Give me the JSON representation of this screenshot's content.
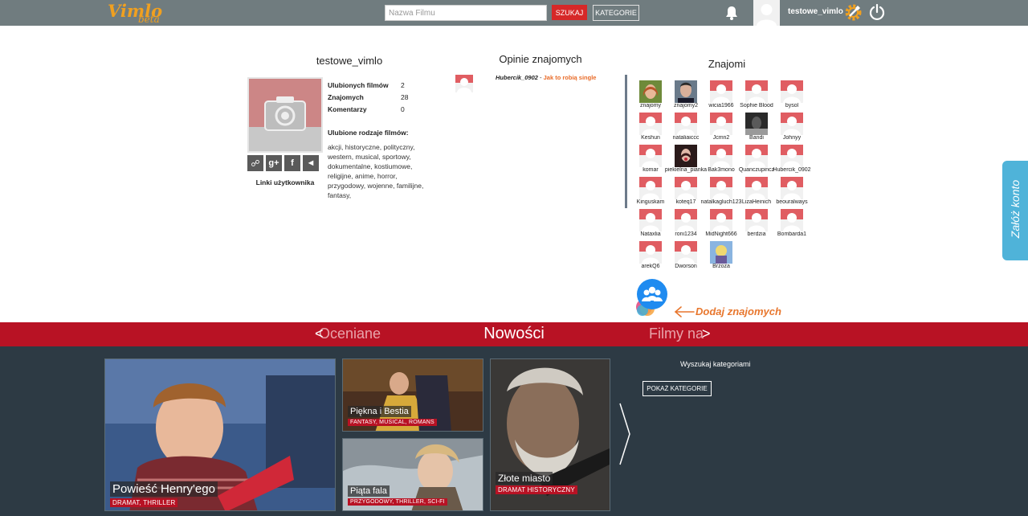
{
  "header": {
    "logo_main": "Vimlo",
    "logo_sub": "beta",
    "search_placeholder": "Nazwa Filmu",
    "search_button": "SZUKAJ",
    "categories_button": "KATEGORIE",
    "username": "testowe_vimlo"
  },
  "profile": {
    "name": "testowe_vimlo",
    "stats": [
      {
        "label": "Ulubionych filmów",
        "value": "2"
      },
      {
        "label": "Znajomych",
        "value": "28"
      },
      {
        "label": "Komentarzy",
        "value": "0"
      }
    ],
    "genres_title": "Ulubione rodzaje filmów:",
    "genres": "akcji, historyczne, polityczny, western, musical, sportowy, dokumentalne, kostiumowe, religijne, anime, horror, przygodowy, wojenne, familijne, fantasy,",
    "links_label": "Linki użytkownika",
    "social_icons": [
      "link-icon",
      "google-plus-icon",
      "facebook-icon",
      "twitter-icon"
    ]
  },
  "opinions": {
    "title": "Opinie znajomych",
    "items": [
      {
        "user": "Hubercik_0902",
        "separator": " - ",
        "movie": "Jak to robią single"
      }
    ]
  },
  "friends": {
    "title": "Znajomi",
    "items": [
      {
        "name": "znajomy",
        "avatar": "photo-redhead"
      },
      {
        "name": "znajomy2",
        "avatar": "photo-man"
      },
      {
        "name": "wicia1966",
        "avatar": "default"
      },
      {
        "name": "Sophie Blood",
        "avatar": "default"
      },
      {
        "name": "bysol",
        "avatar": "default"
      },
      {
        "name": "Keshun",
        "avatar": "default"
      },
      {
        "name": "nataliaiccc",
        "avatar": "default"
      },
      {
        "name": "Jcmn2",
        "avatar": "default"
      },
      {
        "name": "Bandi",
        "avatar": "photo-dark"
      },
      {
        "name": "Johnyy",
        "avatar": "default"
      },
      {
        "name": "komar",
        "avatar": "default"
      },
      {
        "name": "piekielna_pianka",
        "avatar": "photo-woman"
      },
      {
        "name": "Bak3mono",
        "avatar": "default"
      },
      {
        "name": "Quanczupincz",
        "avatar": "default"
      },
      {
        "name": "Hubercik_0902",
        "avatar": "default"
      },
      {
        "name": "Kinguskam",
        "avatar": "default"
      },
      {
        "name": "koteq17",
        "avatar": "default"
      },
      {
        "name": "natalkagluch123",
        "avatar": "default"
      },
      {
        "name": "LizaHeinich",
        "avatar": "default"
      },
      {
        "name": "beouralways",
        "avatar": "default"
      },
      {
        "name": "Nataxlia",
        "avatar": "default"
      },
      {
        "name": "roni1234",
        "avatar": "default"
      },
      {
        "name": "MidNight666",
        "avatar": "default"
      },
      {
        "name": "berdzia",
        "avatar": "default"
      },
      {
        "name": "Bombarda1",
        "avatar": "default"
      },
      {
        "name": "arekQ6",
        "avatar": "default"
      },
      {
        "name": "Dworson",
        "avatar": "default"
      },
      {
        "name": "Brzoza",
        "avatar": "photo-cartoon"
      }
    ],
    "add_label": "Dodaj znajomych"
  },
  "side_tab": "Załóż konto",
  "carousel": {
    "prev_arrow": "<",
    "next_arrow": ">",
    "prev_label": "Oceniane",
    "current_label": "Nowości",
    "next_label": "Filmy na"
  },
  "movies": [
    {
      "title": "Powieść Henry'ego",
      "genres": "DRAMAT, THRILLER"
    },
    {
      "title": "Piękna i Bestia",
      "genres": "FANTASY, MUSICAL, ROMANS"
    },
    {
      "title": "Piąta fala",
      "genres": "PRZYGODOWY, THRILLER, SCI-FI"
    },
    {
      "title": "Złote miasto",
      "genres": "DRAMAT HISTORYCZNY"
    }
  ],
  "category_search": {
    "label": "Wyszukaj kategoriami",
    "button": "POKAŻ KATEGORIE"
  },
  "colors": {
    "topbar": "#707c7f",
    "accent_red": "#b81224",
    "search_red": "#d62828",
    "dark_bg": "#2d3a44",
    "orange": "#e8772e",
    "side_tab": "#4fb3d9"
  }
}
